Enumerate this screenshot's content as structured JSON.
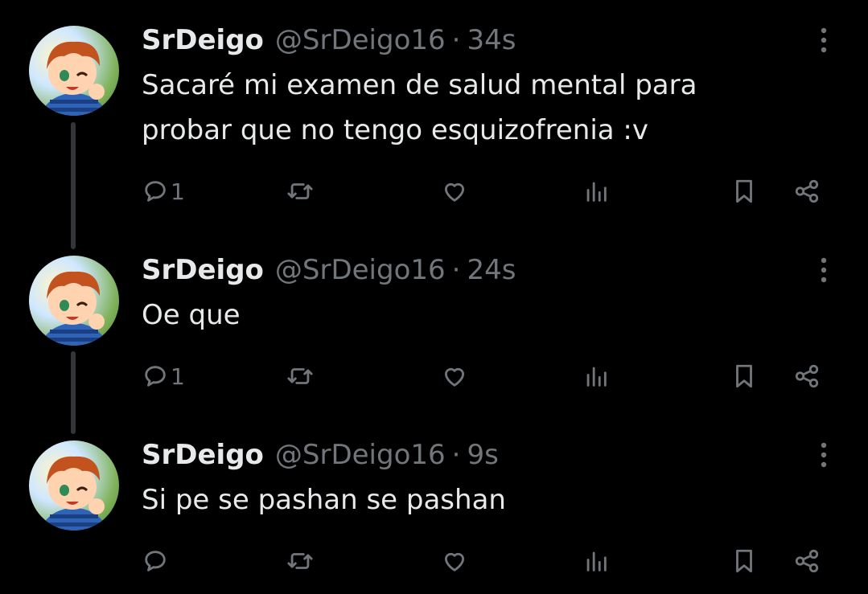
{
  "tweets": [
    {
      "name": "SrDeigo",
      "handle": "@SrDeigo16",
      "separator": "·",
      "time": "34s",
      "text_lines": [
        "Sacaré mi examen de salud mental para",
        "probar que no tengo esquizofrenia :v"
      ],
      "reply_count": "1"
    },
    {
      "name": "SrDeigo",
      "handle": "@SrDeigo16",
      "separator": "·",
      "time": "24s",
      "text_lines": [
        "Oe que"
      ],
      "reply_count": "1"
    },
    {
      "name": "SrDeigo",
      "handle": "@SrDeigo16",
      "separator": "·",
      "time": "9s",
      "text_lines": [
        "Si pe se pashan se pashan"
      ],
      "reply_count": ""
    }
  ],
  "icons": {
    "reply": "reply-icon",
    "retweet": "retweet-icon",
    "like": "heart-icon",
    "views": "views-icon",
    "bookmark": "bookmark-icon",
    "share": "share-icon",
    "more": "more-icon"
  },
  "colors": {
    "background": "#000000",
    "primary_text": "#e7e9ea",
    "secondary_text": "#71767b",
    "thread_line": "#333639"
  }
}
